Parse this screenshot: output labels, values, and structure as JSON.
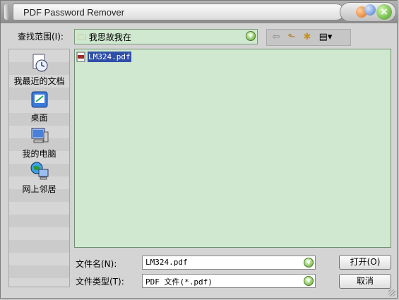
{
  "window": {
    "title": "PDF Password Remover"
  },
  "look_in": {
    "label": "查找范围(I):",
    "value": "我思故我在"
  },
  "places": [
    {
      "label": "我最近的文档",
      "icon": "recent-documents-icon"
    },
    {
      "label": "桌面",
      "icon": "desktop-icon"
    },
    {
      "label": "我的电脑",
      "icon": "my-computer-icon"
    },
    {
      "label": "网上邻居",
      "icon": "network-places-icon"
    }
  ],
  "files": [
    {
      "name": "LM324.pdf",
      "icon": "pdf-file-icon",
      "selected": true
    }
  ],
  "file_name": {
    "label": "文件名(N):",
    "value": "LM324.pdf"
  },
  "file_type": {
    "label": "文件类型(T):",
    "value": "PDF 文件(*.pdf)"
  },
  "buttons": {
    "open": "打开(O)",
    "cancel": "取消"
  },
  "colors": {
    "list_bg": "#cfe8cf",
    "selection": "#2f4fa8"
  }
}
